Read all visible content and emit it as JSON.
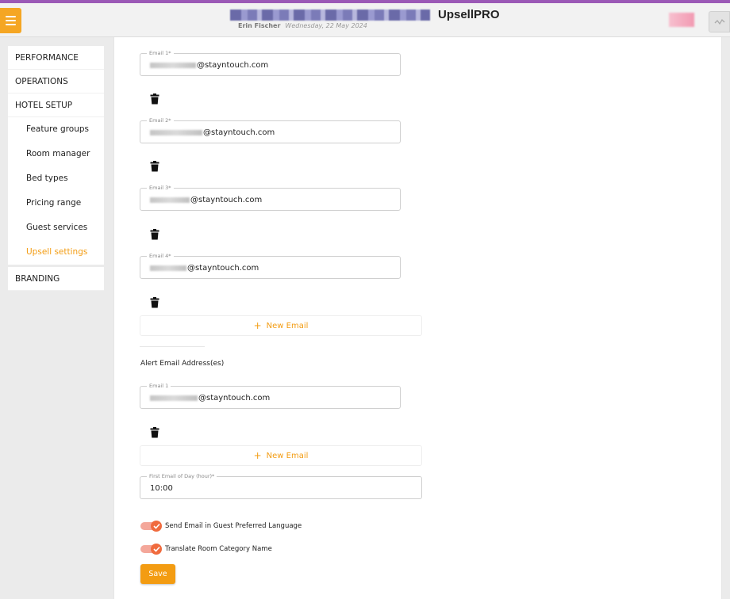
{
  "app": {
    "name": "UpsellPRO",
    "user_name": "Erin Fischer",
    "date": "Wednesday, 22 May 2024"
  },
  "sidebar": {
    "performance": "PERFORMANCE",
    "operations": "OPERATIONS",
    "hotel_setup": "HOTEL SETUP",
    "sub_items": [
      {
        "label": "Feature groups"
      },
      {
        "label": "Room manager"
      },
      {
        "label": "Bed types"
      },
      {
        "label": "Pricing range"
      },
      {
        "label": "Guest services"
      },
      {
        "label": "Upsell settings",
        "active": true
      }
    ],
    "branding": "BRANDING"
  },
  "emails": [
    {
      "label": "Email 1*",
      "domain": "@stayntouch.com"
    },
    {
      "label": "Email 2*",
      "domain": "@stayntouch.com"
    },
    {
      "label": "Email 3*",
      "domain": "@stayntouch.com"
    },
    {
      "label": "Email 4*",
      "domain": "@stayntouch.com"
    }
  ],
  "new_email_label": "New Email",
  "alert_section": {
    "title": "Alert Email Address(es)",
    "emails": [
      {
        "label": "Email 1",
        "domain": "@stayntouch.com"
      }
    ]
  },
  "first_email_hour": {
    "label": "First Email of Day (hour)*",
    "value": "10:00"
  },
  "toggles": {
    "guest_language": {
      "label": "Send Email in Guest Preferred Language",
      "checked": true
    },
    "translate_room": {
      "label": "Translate Room Category Name",
      "checked": true
    }
  },
  "save_label": "Save",
  "colors": {
    "accent": "#f39c12",
    "toggle_knob": "#f06b3e",
    "top_strip": "#9b59b6"
  }
}
